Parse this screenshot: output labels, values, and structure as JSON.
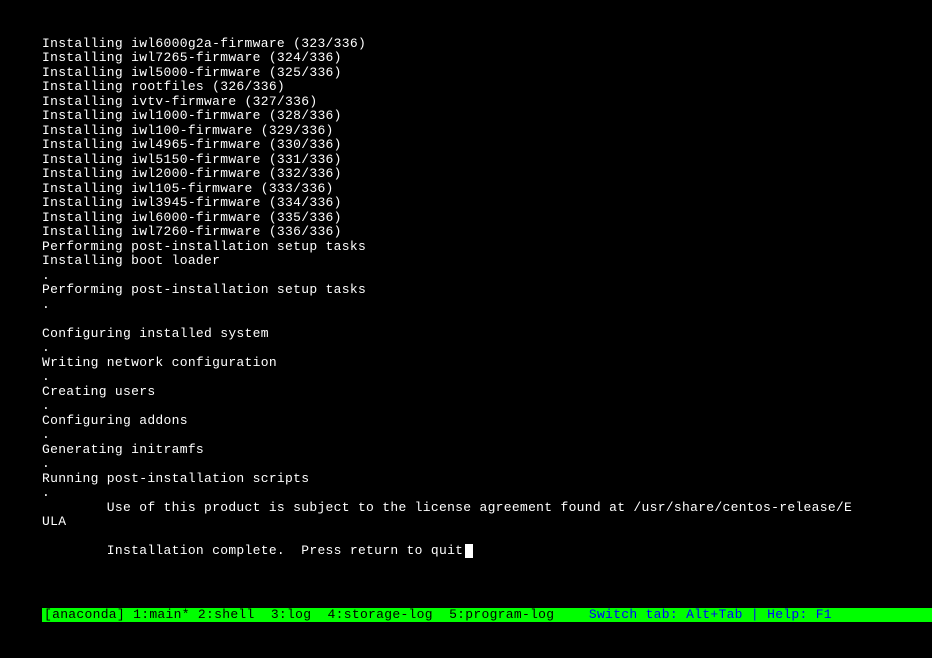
{
  "lines": [
    "Installing iwl6000g2a-firmware (323/336)",
    "Installing iwl7265-firmware (324/336)",
    "Installing iwl5000-firmware (325/336)",
    "Installing rootfiles (326/336)",
    "Installing ivtv-firmware (327/336)",
    "Installing iwl1000-firmware (328/336)",
    "Installing iwl100-firmware (329/336)",
    "Installing iwl4965-firmware (330/336)",
    "Installing iwl5150-firmware (331/336)",
    "Installing iwl2000-firmware (332/336)",
    "Installing iwl105-firmware (333/336)",
    "Installing iwl3945-firmware (334/336)",
    "Installing iwl6000-firmware (335/336)",
    "Installing iwl7260-firmware (336/336)",
    "Performing post-installation setup tasks",
    "Installing boot loader",
    ".",
    "Performing post-installation setup tasks",
    ".",
    "",
    "Configuring installed system",
    ".",
    "Writing network configuration",
    ".",
    "Creating users",
    ".",
    "Configuring addons",
    ".",
    "Generating initramfs",
    ".",
    "Running post-installation scripts",
    ".",
    "        Use of this product is subject to the license agreement found at /usr/share/centos-release/E",
    "ULA",
    "",
    "        Installation complete.  Press return to quit"
  ],
  "statusbar": {
    "left": "[anaconda] 1:main* 2:shell  3:log  4:storage-log  5:program-log ",
    "right": "Switch tab: Alt+Tab | Help: F1 "
  }
}
